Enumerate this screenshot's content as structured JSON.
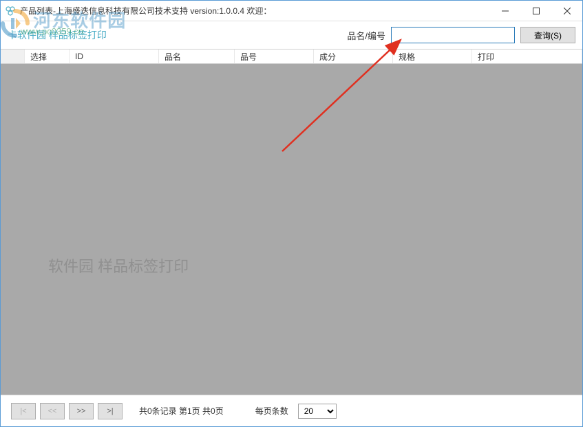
{
  "titlebar": {
    "text": "产品列表-上海盛迭信息科技有限公司技术支持 version:1.0.0.4 欢迎："
  },
  "toolbar": {
    "app_title": "卡软件园 样品标签打印",
    "search_label": "品名/编号",
    "search_value": "",
    "search_button": "查询(S)"
  },
  "table": {
    "columns": {
      "select": "选择",
      "id": "ID",
      "name": "品名",
      "code": "品号",
      "ingredient": "成分",
      "spec": "规格",
      "print": "打印"
    }
  },
  "footer": {
    "first": "|<",
    "prev": "<<",
    "next": ">>",
    "last": ">|",
    "info": "共0条记录 第1页 共0页",
    "page_size_label": "每页条数",
    "page_size_value": "20"
  },
  "watermarks": {
    "site_name": "河东软件园",
    "site_url": "www.pc0359.cn",
    "faint_text": "软件园 样品标签打印"
  }
}
